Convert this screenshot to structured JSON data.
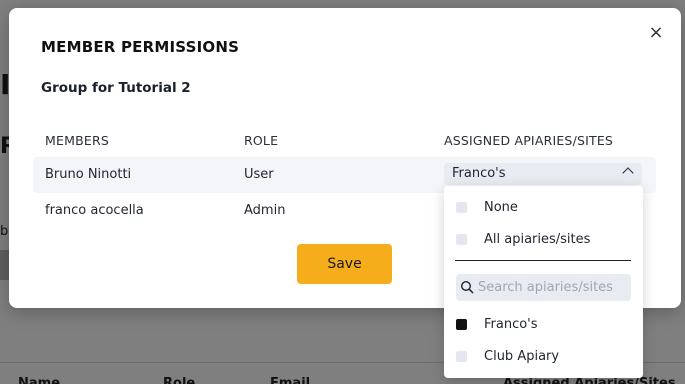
{
  "background": {
    "fragment_large": "IC",
    "fragment_mid": "RS",
    "fragment_small": "bu",
    "table_headers": [
      "Name",
      "Role",
      "Email",
      "Assigned Apiaries/Sites"
    ]
  },
  "modal": {
    "title": "MEMBER PERMISSIONS",
    "close_symbol": "×",
    "group_name": "Group for Tutorial 2",
    "columns": {
      "members": "MEMBERS",
      "role": "ROLE",
      "assigned": "ASSIGNED APIARIES/SITES"
    },
    "rows": [
      {
        "member": "Bruno Ninotti",
        "role": "User",
        "assigned": "Franco's"
      },
      {
        "member": "franco acocella",
        "role": "Admin",
        "assigned": ""
      }
    ],
    "save_label": "Save"
  },
  "dropdown": {
    "options_top": [
      {
        "label": "None",
        "checked": false
      },
      {
        "label": "All apiaries/sites",
        "checked": false
      }
    ],
    "search_placeholder": "Search apiaries/sites",
    "options_list": [
      {
        "label": "Franco's",
        "checked": true
      },
      {
        "label": "Club Apiary",
        "checked": false
      }
    ]
  },
  "colors": {
    "accent": "#f5ad1b",
    "overlay": "rgba(0,0,0,0.5)",
    "field_bg": "#e8ebf1"
  }
}
